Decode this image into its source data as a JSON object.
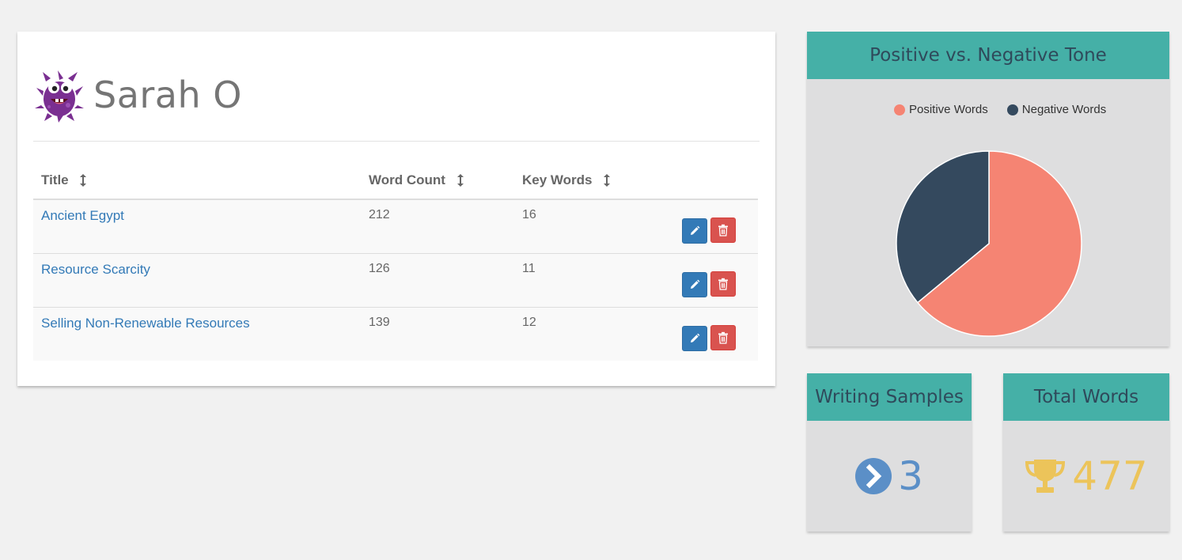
{
  "profile": {
    "name": "Sarah O",
    "avatar_icon": "purple-monster-avatar"
  },
  "table": {
    "headers": {
      "title": "Title",
      "word_count": "Word Count",
      "key_words": "Key Words"
    },
    "rows": [
      {
        "title": "Ancient Egypt",
        "word_count": "212",
        "key_words": "16"
      },
      {
        "title": "Resource Scarcity",
        "word_count": "126",
        "key_words": "11"
      },
      {
        "title": "Selling Non-Renewable Resources",
        "word_count": "139",
        "key_words": "12"
      }
    ],
    "edit_icon": "pencil-icon",
    "delete_icon": "trash-icon"
  },
  "tone_panel": {
    "title": "Positive vs. Negative Tone",
    "legend": [
      "Positive Words",
      "Negative Words"
    ]
  },
  "chart_data": {
    "type": "pie",
    "title": "Positive vs. Negative Tone",
    "categories": [
      "Positive Words",
      "Negative Words"
    ],
    "values": [
      64,
      36
    ],
    "colors": [
      "#f58473",
      "#34495e"
    ],
    "legend_position": "top"
  },
  "samples_panel": {
    "title": "Writing Samples",
    "value": "3",
    "icon": "chevron-circle-right-icon",
    "color": "#5b8fc7"
  },
  "words_panel": {
    "title": "Total Words",
    "value": "477",
    "icon": "trophy-icon",
    "color": "#ecc45a"
  },
  "colors": {
    "header_teal": "#45b0a7",
    "link_blue": "#337ab7",
    "delete_red": "#d9534f",
    "panel_gray": "#dededf"
  }
}
